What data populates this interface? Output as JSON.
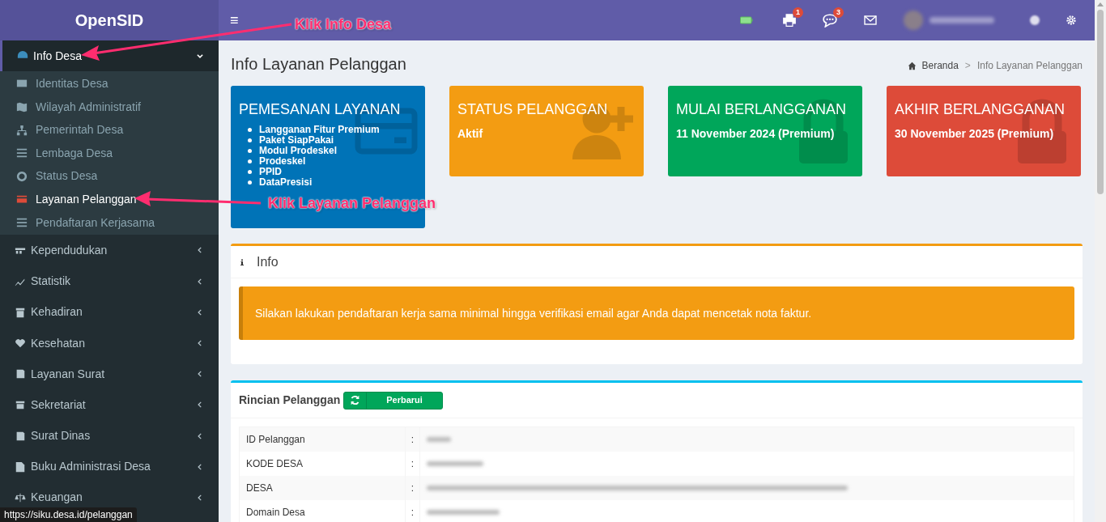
{
  "app": {
    "name": "OpenSID"
  },
  "topbar": {
    "menu_glyph": "≡",
    "badges": [
      {
        "kind": "print",
        "count": "1"
      },
      {
        "kind": "chat",
        "count": "3"
      }
    ]
  },
  "sidebar": {
    "items": [
      {
        "label": "Info Desa",
        "expanded": true,
        "selected": true,
        "children": [
          {
            "label": "Identitas Desa",
            "selected": false
          },
          {
            "label": "Wilayah Administratif",
            "selected": false
          },
          {
            "label": "Pemerintah Desa",
            "selected": false
          },
          {
            "label": "Lembaga Desa",
            "selected": false
          },
          {
            "label": "Status Desa",
            "selected": false
          },
          {
            "label": "Layanan Pelanggan",
            "selected": true
          },
          {
            "label": "Pendaftaran Kerjasama",
            "selected": false
          }
        ]
      },
      {
        "label": "Kependudukan",
        "expanded": false,
        "selected": false
      },
      {
        "label": "Statistik",
        "expanded": false,
        "selected": false
      },
      {
        "label": "Kehadiran",
        "expanded": false,
        "selected": false
      },
      {
        "label": "Kesehatan",
        "expanded": false,
        "selected": false
      },
      {
        "label": "Layanan Surat",
        "expanded": false,
        "selected": false
      },
      {
        "label": "Sekretariat",
        "expanded": false,
        "selected": false
      },
      {
        "label": "Surat Dinas",
        "expanded": false,
        "selected": false
      },
      {
        "label": "Buku Administrasi Desa",
        "expanded": false,
        "selected": false
      },
      {
        "label": "Keuangan",
        "expanded": false,
        "selected": false
      }
    ]
  },
  "page": {
    "title": "Info Layanan Pelanggan",
    "breadcrumb": [
      "Beranda",
      "Info Layanan Pelanggan"
    ],
    "breadcrumb_separator": ">"
  },
  "cards": [
    {
      "kind": "list",
      "title": "PEMESANAN LAYANAN",
      "color": "#0073b7",
      "items": [
        "Langganan Fitur Premium",
        "Paket SiapPakai",
        "Modul Prodeskel",
        "Prodeskel",
        "PPID",
        "DataPresisi"
      ]
    },
    {
      "kind": "text",
      "title": "STATUS PELANGGAN",
      "color": "#f39c12",
      "value": "Aktif"
    },
    {
      "kind": "text",
      "title": "MULAI BERLANGGANAN",
      "color": "#00a65a",
      "value": "11 November 2024 (Premium)"
    },
    {
      "kind": "text",
      "title": "AKHIR BERLANGGANAN",
      "color": "#dd4b39",
      "value": "30 November 2025 (Premium)"
    }
  ],
  "info_box": {
    "title": "Info",
    "message": "Silakan lakukan pendaftaran kerja sama minimal hingga verifikasi email agar Anda dapat mencetak nota faktur."
  },
  "details": {
    "title": "Rincian Pelanggan",
    "button": "Perbarui",
    "rows": [
      {
        "label": "ID Pelanggan",
        "separator": ":"
      },
      {
        "label": "KODE DESA",
        "separator": ":"
      },
      {
        "label": "DESA",
        "separator": ":"
      },
      {
        "label": "Domain Desa",
        "separator": ":"
      }
    ]
  },
  "annotations": [
    "Klik Info Desa",
    "Klik Layanan Pelanggan"
  ],
  "status_url": "https://siku.desa.id/pelanggan"
}
